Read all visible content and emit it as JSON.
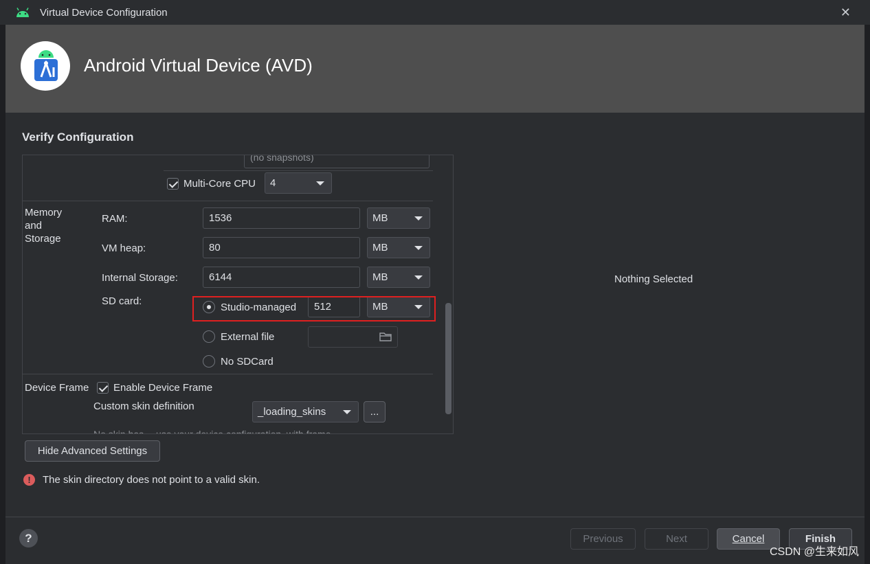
{
  "window": {
    "title": "Virtual Device Configuration",
    "close_glyph": "✕"
  },
  "header": {
    "title": "Android Virtual Device (AVD)"
  },
  "section_title": "Verify Configuration",
  "snapshot": {
    "value": "(no snapshots)"
  },
  "cpu": {
    "label": "Multi-Core CPU",
    "checked": true,
    "value": "4"
  },
  "memory": {
    "group_label_1": "Memory",
    "group_label_2": "and",
    "group_label_3": "Storage",
    "ram": {
      "label": "RAM:",
      "value": "1536",
      "unit": "MB"
    },
    "vm_heap": {
      "label": "VM heap:",
      "value": "80",
      "unit": "MB"
    },
    "internal": {
      "label": "Internal Storage:",
      "value": "6144",
      "unit": "MB"
    },
    "sdcard": {
      "label": "SD card:",
      "studio_managed": {
        "label": "Studio-managed",
        "value": "512",
        "unit": "MB",
        "selected": true
      },
      "external": {
        "label": "External file",
        "value": ""
      },
      "none": {
        "label": "No SDCard"
      }
    }
  },
  "device_frame": {
    "label": "Device Frame",
    "enable_label": "Enable Device Frame",
    "custom_skin_label": "Custom skin definition",
    "skin_value": "_loading_skins",
    "browse_label": "...",
    "cut_text": "No skin has… use your device configuration, with frame"
  },
  "right_panel": {
    "nothing_selected": "Nothing Selected"
  },
  "buttons": {
    "hide_advanced": "Hide Advanced Settings",
    "previous": "Previous",
    "next": "Next",
    "cancel": "Cancel",
    "finish": "Finish"
  },
  "error": {
    "icon": "!",
    "message": "The skin directory does not point to a valid skin."
  },
  "help": {
    "glyph": "?"
  },
  "watermark": "CSDN @生来如风",
  "colors": {
    "accent_red": "#e02020",
    "header_bg": "#4e4e4e",
    "background": "#2b2d30",
    "android_green": "#3ddc84"
  }
}
